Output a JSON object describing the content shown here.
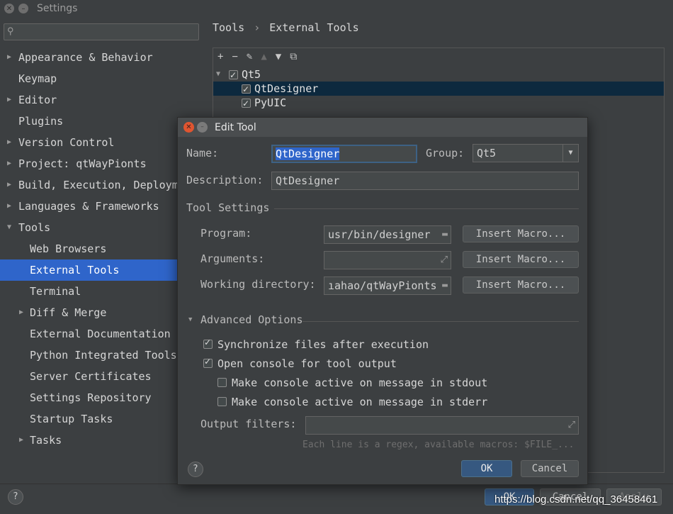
{
  "window": {
    "title": "Settings"
  },
  "search": {
    "placeholder": ""
  },
  "sidebar": {
    "items": [
      {
        "label": "Appearance & Behavior",
        "expandable": true
      },
      {
        "label": "Keymap",
        "expandable": false
      },
      {
        "label": "Editor",
        "expandable": true
      },
      {
        "label": "Plugins",
        "expandable": false
      },
      {
        "label": "Version Control",
        "expandable": true
      },
      {
        "label": "Project: qtWayPionts",
        "expandable": true
      },
      {
        "label": "Build, Execution, Deployment",
        "expandable": true
      },
      {
        "label": "Languages & Frameworks",
        "expandable": true
      },
      {
        "label": "Tools",
        "expandable": true,
        "expanded": true
      }
    ],
    "tools_children": [
      {
        "label": "Web Browsers"
      },
      {
        "label": "External Tools",
        "selected": true
      },
      {
        "label": "Terminal"
      },
      {
        "label": "Diff & Merge",
        "expandable": true
      },
      {
        "label": "External Documentation"
      },
      {
        "label": "Python Integrated Tools"
      },
      {
        "label": "Server Certificates"
      },
      {
        "label": "Settings Repository"
      },
      {
        "label": "Startup Tasks"
      },
      {
        "label": "Tasks",
        "expandable": true
      }
    ]
  },
  "breadcrumb": {
    "parent": "Tools",
    "separator": "›",
    "current": "External Tools"
  },
  "toolbar": {
    "add": "+",
    "remove": "−",
    "edit": "✎",
    "up": "▲",
    "down": "▼",
    "copy": "⧉"
  },
  "tools_tree": {
    "group": {
      "label": "Qt5",
      "checked": true
    },
    "tools": [
      {
        "label": "QtDesigner",
        "checked": true,
        "selected": true
      },
      {
        "label": "PyUIC",
        "checked": true
      }
    ]
  },
  "dialog": {
    "title": "Edit Tool",
    "name_label": "Name:",
    "name_value": "QtDesigner",
    "group_label": "Group:",
    "group_value": "Qt5",
    "description_label": "Description:",
    "description_value": "QtDesigner",
    "tool_settings_title": "Tool Settings",
    "program_label": "Program:",
    "program_value": "usr/bin/designer",
    "arguments_label": "Arguments:",
    "arguments_value": "",
    "workdir_label": "Working directory:",
    "workdir_value": "ıahao/qtWayPionts",
    "insert_macro": "Insert Macro...",
    "advanced_title": "Advanced Options",
    "sync_label": "Synchronize files after execution",
    "sync_checked": true,
    "console_label": "Open console for tool output",
    "console_checked": true,
    "stdout_label": "Make console active on message in stdout",
    "stdout_checked": false,
    "stderr_label": "Make console active on message in stderr",
    "stderr_checked": false,
    "output_filters_label": "Output filters:",
    "output_filters_value": "",
    "hint": "Each line is a regex, available macros: $FILE_...",
    "ok": "OK",
    "cancel": "Cancel",
    "help": "?"
  },
  "outer_buttons": {
    "ok": "OK",
    "cancel": "Cancel",
    "apply": "Apply",
    "help": "?"
  },
  "watermark": "https://blog.csdn.net/qq_36458461"
}
